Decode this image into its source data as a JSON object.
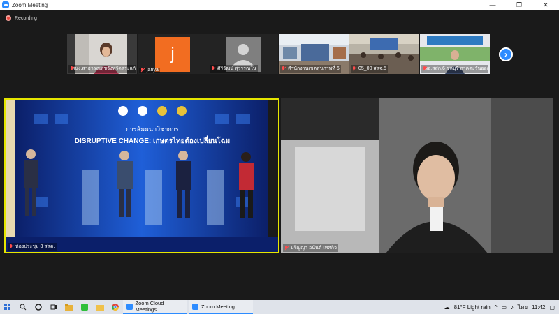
{
  "window": {
    "title": "Zoom Meeting",
    "minimize": "—",
    "maximize": "❐",
    "close": "✕"
  },
  "recording": {
    "label": "Recording"
  },
  "thumbnails": [
    {
      "name": "สนง.สาธารณสุขจังหวัดสระแก้ว",
      "kind": "video"
    },
    {
      "name": "janya",
      "kind": "initial",
      "initial": "j",
      "color": "#f26d21"
    },
    {
      "name": "ศิริวัฒน์ สุวรรณใน",
      "kind": "avatar"
    },
    {
      "name": "สำนักงานเขตสุขภาพที่ 6",
      "kind": "video"
    },
    {
      "name": "05_00 สสจ.5",
      "kind": "video"
    },
    {
      "name": "ผอ.สสก.6 ชลบุรี ภาคตะวันออก",
      "kind": "video"
    }
  ],
  "next_icon": "›",
  "main_left": {
    "label": "ห้องประชุม 3 สสค.",
    "banner_title": "การสัมมนาวิชาการ",
    "banner_headline": "DISRUPTIVE CHANGE: เกษตรไทยต้องเปลี่ยนโฉม"
  },
  "main_right": {
    "label": "ปริญญา อนันต์ เทศกิจ"
  },
  "taskbar": {
    "apps": [
      {
        "label": "Zoom Cloud Meetings"
      },
      {
        "label": "Zoom Meeting"
      }
    ],
    "weather": "81°F  Light rain",
    "lang": "ไทย",
    "time": "11:42"
  },
  "colors": {
    "accent": "#2d8cff",
    "active_speaker": "#e6e600",
    "rec": "#e8453c"
  }
}
